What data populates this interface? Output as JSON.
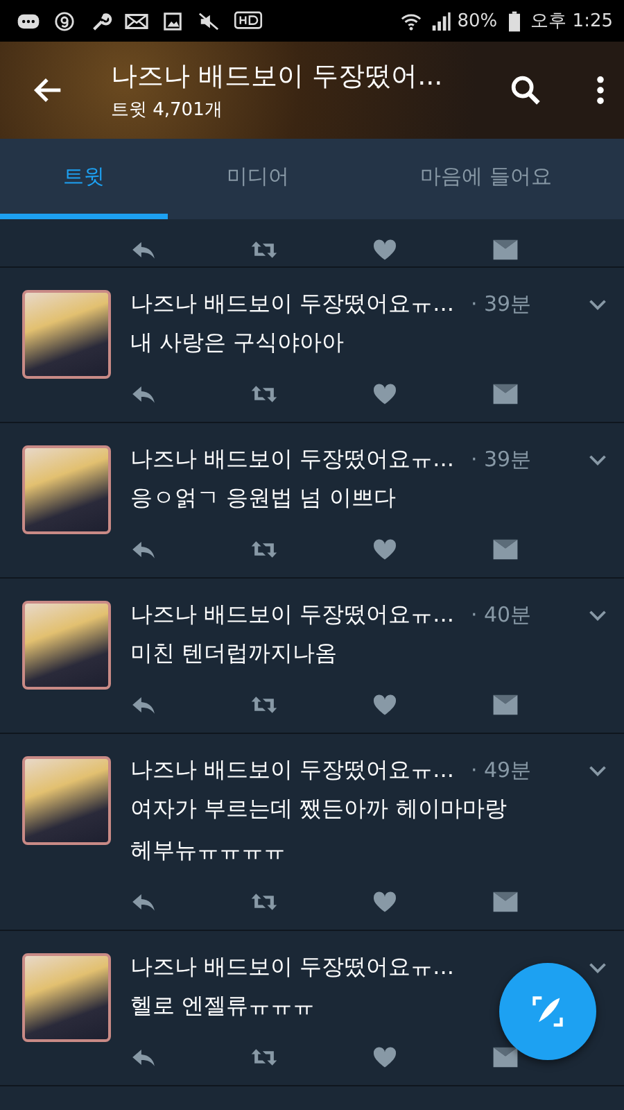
{
  "status_bar": {
    "battery": "80%",
    "time": "오후 1:25"
  },
  "header": {
    "title": "나즈나 배드보이 두장떴어...",
    "subtitle": "트윗 4,701개"
  },
  "tabs": [
    {
      "label": "트윗",
      "selected": true
    },
    {
      "label": "미디어",
      "selected": false
    },
    {
      "label": "마음에 들어요",
      "selected": false
    }
  ],
  "tweets": [
    {
      "name": "나즈나 배드보이 두장떴어요ㅠ...",
      "time": "· 39분",
      "text": "내 사랑은 구식야아아"
    },
    {
      "name": "나즈나 배드보이 두장떴어요ㅠ...",
      "time": "· 39분",
      "text": "응ㅇ얽ㄱ 응원법 넘 이쁘다"
    },
    {
      "name": "나즈나 배드보이 두장떴어요ㅠ...",
      "time": "· 40분",
      "text": "미친 텐더럽까지나옴"
    },
    {
      "name": "나즈나 배드보이 두장떴어요ㅠ...",
      "time": "· 49분",
      "text": "여자가 부르는데 쨌든아까 헤이마마랑 헤부뉴ㅠㅠㅠㅠ"
    },
    {
      "name": "나즈나 배드보이 두장떴어요ㅠ...",
      "text": "헬로 엔젤류ㅠㅠㅠ"
    }
  ]
}
